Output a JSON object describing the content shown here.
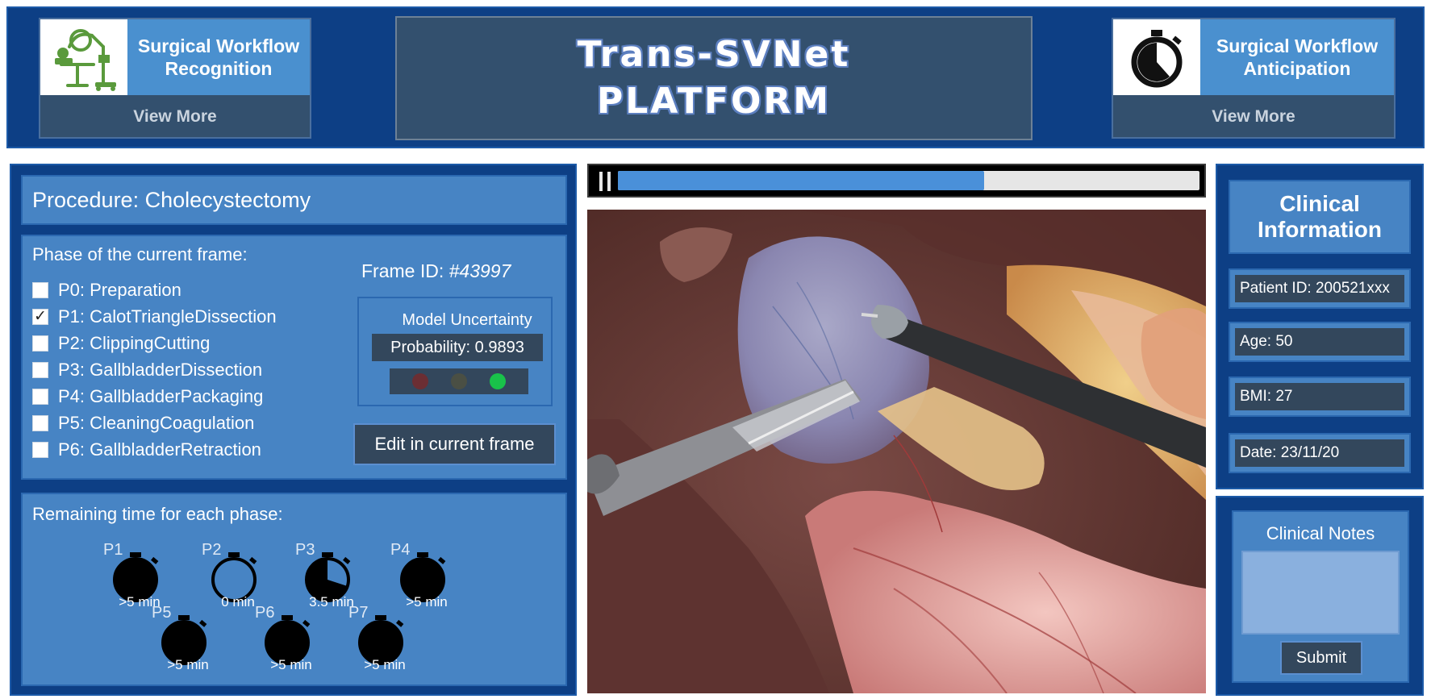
{
  "header": {
    "recognition": {
      "title_line1": "Surgical Workflow",
      "title_line2": "Recognition",
      "link_label": "View More"
    },
    "platform": {
      "line1": "Trans-SVNet",
      "line2": "PLATFORM"
    },
    "anticipation": {
      "title_line1": "Surgical Workflow",
      "title_line2": "Anticipation",
      "link_label": "View More"
    }
  },
  "procedure": {
    "label": "Procedure: Cholecystectomy"
  },
  "phase_panel": {
    "heading": "Phase of the current frame:",
    "phases": [
      {
        "label": "P0: Preparation",
        "checked": false
      },
      {
        "label": "P1: CalotTriangleDissection",
        "checked": true
      },
      {
        "label": "P2: ClippingCutting",
        "checked": false
      },
      {
        "label": "P3: GallbladderDissection",
        "checked": false
      },
      {
        "label": "P4: GallbladderPackaging",
        "checked": false
      },
      {
        "label": "P5: CleaningCoagulation",
        "checked": false
      },
      {
        "label": "P6: GallbladderRetraction",
        "checked": false
      }
    ],
    "check_mark": "✓",
    "frame_id_prefix": "Frame ID: ",
    "frame_id_value": "#43997",
    "uncertainty_title": "Model Uncertainty",
    "probability_text": "Probability: 0.9893",
    "lights": {
      "red": "#6b2e33",
      "yellow": "#4a4f44",
      "green": "#19c24a"
    },
    "edit_button": "Edit in current frame"
  },
  "remaining": {
    "heading": "Remaining time for each phase:",
    "timers": [
      {
        "label": "P1",
        "value": ">5 min",
        "fill": 1.0
      },
      {
        "label": "P2",
        "value": "0 min",
        "fill": 0.0
      },
      {
        "label": "P3",
        "value": "3.5 min",
        "fill": 0.7
      },
      {
        "label": "P4",
        "value": ">5 min",
        "fill": 1.0
      },
      {
        "label": "P5",
        "value": ">5 min",
        "fill": 1.0
      },
      {
        "label": "P6",
        "value": ">5 min",
        "fill": 1.0
      },
      {
        "label": "P7",
        "value": ">5 min",
        "fill": 1.0
      }
    ]
  },
  "video": {
    "progress": 0.63,
    "accent_color": "#4a90d9"
  },
  "clinical": {
    "title": "Clinical Information",
    "patient_id": "Patient ID: 200521xxx",
    "age": "Age: 50",
    "bmi": "BMI: 27",
    "date": "Date: 23/11/20"
  },
  "notes": {
    "title": "Clinical Notes",
    "value": "",
    "submit_label": "Submit"
  },
  "colors": {
    "panel_dark": "#0d3f85",
    "panel_mid": "#4784c4",
    "field_dark": "#33475c",
    "accent_green": "#19c24a"
  },
  "icons": {
    "recognition": "surgical-robot-icon",
    "anticipation": "stopwatch-icon",
    "timer": "stopwatch-icon"
  }
}
